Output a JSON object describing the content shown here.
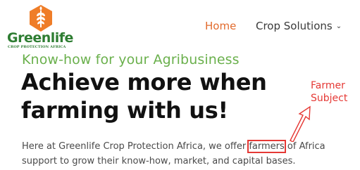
{
  "brand": {
    "name": "Greenlife",
    "tagline": "CROP PROTECTION AFRICA"
  },
  "nav": {
    "items": [
      {
        "label": "Home",
        "active": true
      },
      {
        "label": "Crop Solutions",
        "has_dropdown": true
      }
    ]
  },
  "hero": {
    "kicker": "Know-how for your Agribusiness",
    "headline_line1": "Achieve more when",
    "headline_line2": "farming with us!",
    "body_line1_before": "Here at Greenlife Crop Protection Africa, we offer ",
    "body_highlight": "farmers",
    "body_line1_after": " of Africa",
    "body_line2": "support to grow their know-how, market, and capital bases."
  },
  "annotation": {
    "line1": "Farmer",
    "line2": "Subject"
  },
  "colors": {
    "brand_green": "#2e7d32",
    "leaf_orange": "#ef7d28",
    "accent_orange": "#e26a2c",
    "kicker_green": "#6ab04c",
    "annotation_red": "#e53935",
    "headline": "#111111"
  },
  "icons": {
    "logo": "wheat-in-orange-hexagon-icon",
    "dropdown": "chevron-down-icon",
    "arrow": "arrow-icon"
  }
}
